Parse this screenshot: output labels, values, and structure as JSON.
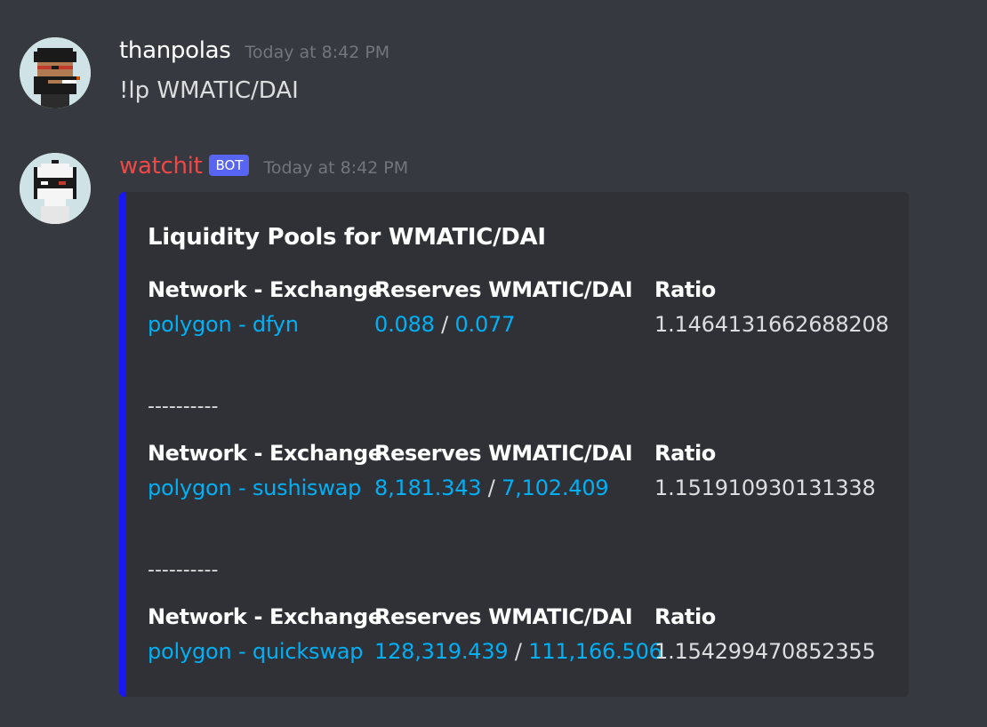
{
  "messages": [
    {
      "username": "thanpolas",
      "username_color": "#ffffff",
      "timestamp": "Today at 8:42 PM",
      "content": "!lp WMATIC/DAI",
      "avatar_icon": "pixel-avatar-bearded-man"
    },
    {
      "username": "watchit",
      "username_color": "#f04747",
      "bot_badge": "BOT",
      "timestamp": "Today at 8:42 PM",
      "avatar_icon": "pixel-avatar-robot",
      "embed": {
        "accent_color": "#1a18f2",
        "title": "Liquidity Pools for WMATIC/DAI",
        "column_headers": [
          "Network - Exchange",
          "Reserves WMATIC/DAI",
          "Ratio"
        ],
        "separator": "----------",
        "pools": [
          {
            "network_exchange": "polygon - dfyn",
            "reserve_a": "0.088",
            "reserve_sep": "/",
            "reserve_b": "0.077",
            "ratio": "1.1464131662688208"
          },
          {
            "network_exchange": "polygon - sushiswap",
            "reserve_a": "8,181.343",
            "reserve_sep": "/",
            "reserve_b": "7,102.409",
            "ratio": "1.151910930131338"
          },
          {
            "network_exchange": "polygon - quickswap",
            "reserve_a": "128,319.439",
            "reserve_sep": "/",
            "reserve_b": "111,166.506",
            "ratio": "1.154299470852355"
          }
        ]
      }
    }
  ]
}
